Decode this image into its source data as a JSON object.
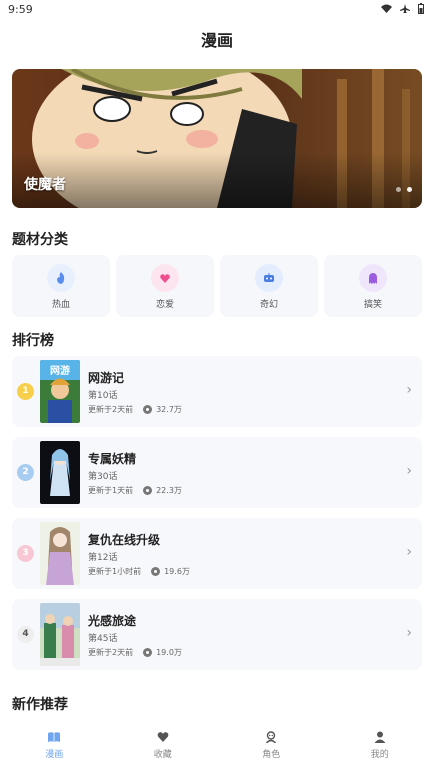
{
  "status_bar": {
    "time": "9:59"
  },
  "header": {
    "title": "漫画"
  },
  "banner": {
    "title": "使魔者",
    "dot_count": 2
  },
  "categories_section": {
    "title": "题材分类",
    "items": [
      {
        "label": "热血",
        "icon": "flame-icon",
        "bg": "#e8f0fe",
        "color": "#5b8def"
      },
      {
        "label": "恋爱",
        "icon": "heart-icon",
        "bg": "#fde5ef",
        "color": "#ef4f8d"
      },
      {
        "label": "奇幻",
        "icon": "robot-icon",
        "bg": "#e3edfd",
        "color": "#4a7de0"
      },
      {
        "label": "搞笑",
        "icon": "ghost-icon",
        "bg": "#efe6fb",
        "color": "#9a5de0"
      }
    ]
  },
  "ranking_section": {
    "title": "排行榜",
    "items": [
      {
        "rank": "1",
        "name": "网游记",
        "episode": "第10话",
        "updated": "更新于2天前",
        "views": "32.7万",
        "badge_color": "#f7cf4b"
      },
      {
        "rank": "2",
        "name": "专属妖精",
        "episode": "第30话",
        "updated": "更新于1天前",
        "views": "22.3万",
        "badge_color": "#a9cdf2"
      },
      {
        "rank": "3",
        "name": "复仇在线升级",
        "episode": "第12话",
        "updated": "更新于1小时前",
        "views": "19.6万",
        "badge_color": "#f7c7d4"
      },
      {
        "rank": "4",
        "name": "光感旅途",
        "episode": "第45话",
        "updated": "更新于2天前",
        "views": "19.0万",
        "badge_color": "#eeeeee"
      }
    ]
  },
  "new_section": {
    "title": "新作推荐"
  },
  "tabbar": {
    "tabs": [
      {
        "label": "漫画",
        "icon": "book-icon",
        "active": true
      },
      {
        "label": "收藏",
        "icon": "heart-icon",
        "active": false
      },
      {
        "label": "角色",
        "icon": "character-icon",
        "active": false
      },
      {
        "label": "我的",
        "icon": "user-icon",
        "active": false
      }
    ],
    "active_color": "#6fa6ef",
    "inactive_color": "#666666"
  }
}
